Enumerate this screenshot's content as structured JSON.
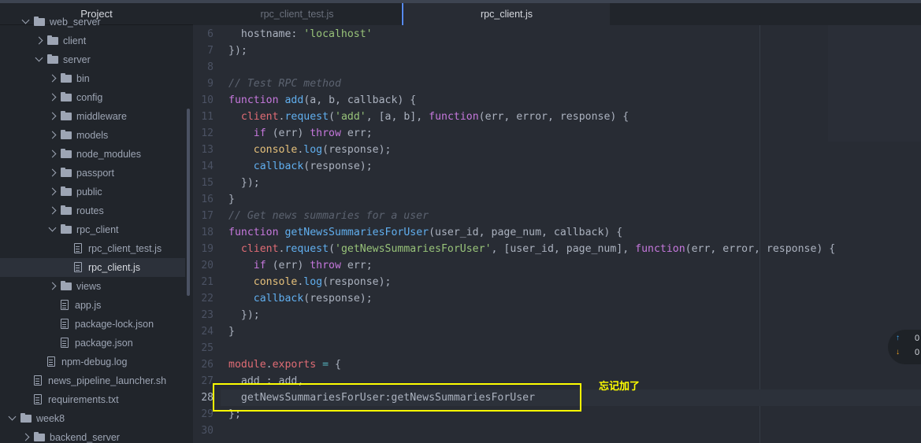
{
  "tree": {
    "header": "Project",
    "rows": [
      {
        "label": "web_server",
        "type": "folder",
        "state": "open"
      },
      {
        "label": "client",
        "type": "folder",
        "state": "closed"
      },
      {
        "label": "server",
        "type": "folder",
        "state": "open"
      },
      {
        "label": "bin",
        "type": "folder",
        "state": "closed"
      },
      {
        "label": "config",
        "type": "folder",
        "state": "closed"
      },
      {
        "label": "middleware",
        "type": "folder",
        "state": "closed"
      },
      {
        "label": "models",
        "type": "folder",
        "state": "closed"
      },
      {
        "label": "node_modules",
        "type": "folder",
        "state": "closed"
      },
      {
        "label": "passport",
        "type": "folder",
        "state": "closed"
      },
      {
        "label": "public",
        "type": "folder",
        "state": "closed"
      },
      {
        "label": "routes",
        "type": "folder",
        "state": "closed"
      },
      {
        "label": "rpc_client",
        "type": "folder",
        "state": "open"
      },
      {
        "label": "rpc_client_test.js",
        "type": "file"
      },
      {
        "label": "rpc_client.js",
        "type": "file",
        "selected": true
      },
      {
        "label": "views",
        "type": "folder",
        "state": "closed"
      },
      {
        "label": "app.js",
        "type": "file"
      },
      {
        "label": "package-lock.json",
        "type": "file"
      },
      {
        "label": "package.json",
        "type": "file"
      },
      {
        "label": "npm-debug.log",
        "type": "file"
      },
      {
        "label": "news_pipeline_launcher.sh",
        "type": "file"
      },
      {
        "label": "requirements.txt",
        "type": "file"
      },
      {
        "label": "week8",
        "type": "folder",
        "state": "open"
      },
      {
        "label": "backend_server",
        "type": "folder",
        "state": "closed"
      }
    ]
  },
  "tabs": [
    {
      "label": "rpc_client_test.js",
      "active": false
    },
    {
      "label": "rpc_client.js",
      "active": true
    }
  ],
  "editor": {
    "cursor_line": "28",
    "lines": [
      {
        "n": "6",
        "tokens": [
          [
            "",
            "  hostname: "
          ],
          [
            "str",
            "'localhost'"
          ]
        ]
      },
      {
        "n": "7",
        "tokens": [
          [
            "",
            "});"
          ]
        ]
      },
      {
        "n": "8",
        "tokens": []
      },
      {
        "n": "9",
        "tokens": [
          [
            "cm",
            "// Test RPC method"
          ]
        ]
      },
      {
        "n": "10",
        "tokens": [
          [
            "kw",
            "function"
          ],
          [
            "",
            " "
          ],
          [
            "fn",
            "add"
          ],
          [
            "",
            "(a, b, callback) {"
          ]
        ]
      },
      {
        "n": "11",
        "tokens": [
          [
            "",
            "  "
          ],
          [
            "var",
            "client"
          ],
          [
            "",
            "."
          ],
          [
            "fn",
            "request"
          ],
          [
            "",
            "("
          ],
          [
            "str",
            "'add'"
          ],
          [
            "",
            ", [a, b], "
          ],
          [
            "kw",
            "function"
          ],
          [
            "",
            "(err, error, response) {"
          ]
        ]
      },
      {
        "n": "12",
        "tokens": [
          [
            "",
            "    "
          ],
          [
            "kw",
            "if"
          ],
          [
            "",
            " (err) "
          ],
          [
            "kw",
            "throw"
          ],
          [
            "",
            " err;"
          ]
        ]
      },
      {
        "n": "13",
        "tokens": [
          [
            "",
            "    "
          ],
          [
            "obj",
            "console"
          ],
          [
            "",
            "."
          ],
          [
            "fn",
            "log"
          ],
          [
            "",
            "(response);"
          ]
        ]
      },
      {
        "n": "14",
        "tokens": [
          [
            "",
            "    "
          ],
          [
            "fn",
            "callback"
          ],
          [
            "",
            "(response);"
          ]
        ]
      },
      {
        "n": "15",
        "tokens": [
          [
            "",
            "  });"
          ]
        ]
      },
      {
        "n": "16",
        "tokens": [
          [
            "",
            "}"
          ]
        ]
      },
      {
        "n": "17",
        "tokens": [
          [
            "cm",
            "// Get news summaries for a user"
          ]
        ]
      },
      {
        "n": "18",
        "tokens": [
          [
            "kw",
            "function"
          ],
          [
            "",
            " "
          ],
          [
            "fn",
            "getNewsSummariesForUser"
          ],
          [
            "",
            "(user_id, page_num, callback) {"
          ]
        ]
      },
      {
        "n": "19",
        "tokens": [
          [
            "",
            "  "
          ],
          [
            "var",
            "client"
          ],
          [
            "",
            "."
          ],
          [
            "fn",
            "request"
          ],
          [
            "",
            "("
          ],
          [
            "str",
            "'getNewsSummariesForUser'"
          ],
          [
            "",
            ", [user_id, page_num], "
          ],
          [
            "kw",
            "function"
          ],
          [
            "",
            "(err, error, response) {"
          ]
        ]
      },
      {
        "n": "20",
        "tokens": [
          [
            "",
            "    "
          ],
          [
            "kw",
            "if"
          ],
          [
            "",
            " (err) "
          ],
          [
            "kw",
            "throw"
          ],
          [
            "",
            " err;"
          ]
        ]
      },
      {
        "n": "21",
        "tokens": [
          [
            "",
            "    "
          ],
          [
            "obj",
            "console"
          ],
          [
            "",
            "."
          ],
          [
            "fn",
            "log"
          ],
          [
            "",
            "(response);"
          ]
        ]
      },
      {
        "n": "22",
        "tokens": [
          [
            "",
            "    "
          ],
          [
            "fn",
            "callback"
          ],
          [
            "",
            "(response);"
          ]
        ]
      },
      {
        "n": "23",
        "tokens": [
          [
            "",
            "  });"
          ]
        ]
      },
      {
        "n": "24",
        "tokens": [
          [
            "",
            "}"
          ]
        ]
      },
      {
        "n": "25",
        "tokens": []
      },
      {
        "n": "26",
        "tokens": [
          [
            "var",
            "module"
          ],
          [
            "",
            "."
          ],
          [
            "var",
            "exports"
          ],
          [
            "",
            " "
          ],
          [
            "op",
            "="
          ],
          [
            "",
            " {"
          ]
        ]
      },
      {
        "n": "27",
        "tokens": [
          [
            "",
            "  add : add,"
          ]
        ]
      },
      {
        "n": "28",
        "tokens": [
          [
            "",
            "  getNewsSummariesForUser:getNewsSummariesForUser"
          ]
        ]
      },
      {
        "n": "29",
        "tokens": [
          [
            "",
            "};"
          ]
        ]
      },
      {
        "n": "30",
        "tokens": []
      }
    ]
  },
  "annotation": {
    "text": "忘记加了",
    "color": "#ffff00"
  },
  "git": {
    "ahead": "0",
    "behind": "0"
  },
  "colors": {
    "accent": "#568af2",
    "keyword": "#c678dd",
    "function": "#61afef",
    "string": "#98c379",
    "comment": "#5c6370"
  }
}
